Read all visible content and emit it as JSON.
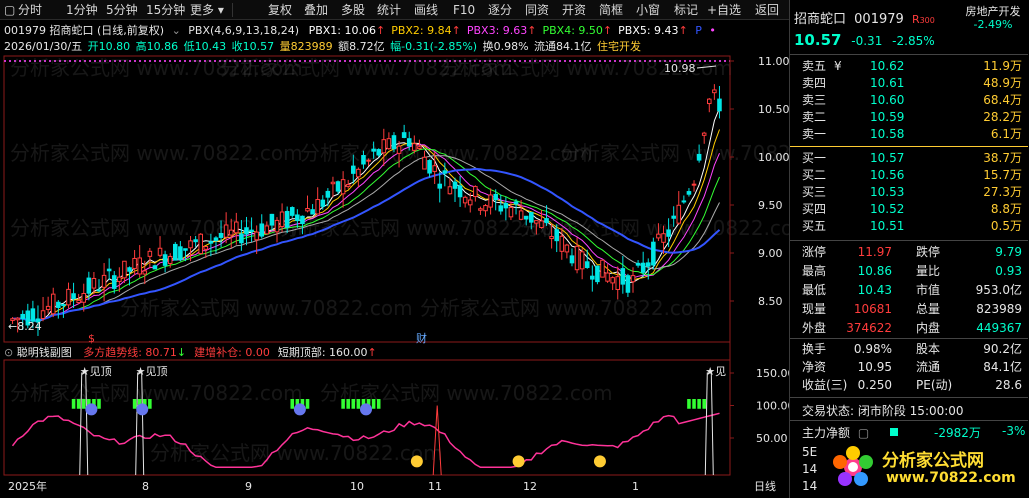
{
  "toolbar": {
    "periods": [
      "分时",
      "1分钟",
      "5分钟",
      "15分钟",
      "更多"
    ],
    "tools": [
      "复权",
      "叠加",
      "多股",
      "统计",
      "画线",
      "F10",
      "逐分",
      "同资",
      "开资",
      "简框",
      "小窗",
      "标记",
      "+自选",
      "返回"
    ]
  },
  "header": {
    "title": "001979 招商蛇口 (日线,前复权)",
    "indicator_name": "PBX(4,6,9,13,18,24)",
    "pbx": [
      {
        "label": "PBX1: 10.06",
        "color": "#ffffff"
      },
      {
        "label": "PBX2: 9.84",
        "color": "#ffcc00"
      },
      {
        "label": "PBX3: 9.63",
        "color": "#ff44ff"
      },
      {
        "label": "PBX4: 9.50",
        "color": "#33ff33"
      },
      {
        "label": "PBX5: 9.43",
        "color": "#ffffff"
      }
    ],
    "pbx_extra": "P",
    "line2": {
      "date": "2026/01/30/五",
      "open": "开10.80",
      "high": "高10.86",
      "low": "低10.43",
      "close": "收10.57",
      "volume": "量823989",
      "amount": "额8.72亿",
      "change": "幅-0.31(-2.85%)",
      "turnover": "换0.98%",
      "float": "流通84.1亿",
      "sector": "住宅开发"
    }
  },
  "main_chart": {
    "price_axis": [
      "11.00",
      "10.50",
      "10.00",
      "9.50",
      "9.00",
      "8.50"
    ],
    "annotations": {
      "high_label": "10.98",
      "low_label": "8.24",
      "marker_s": "$",
      "marker_cai": "财"
    },
    "watermark": "分析家公式网 www.70822.com"
  },
  "sub_chart": {
    "title": "聪明钱副图",
    "items": [
      {
        "label": "多方趋势线: 80.71",
        "color": "#ff3c3c",
        "arrow": "↓",
        "arrow_color": "#33ff33"
      },
      {
        "label": "建增补仓: 0.00",
        "color": "#ff3c3c",
        "arrow": "",
        "arrow_color": ""
      },
      {
        "label": "短期顶部: 160.00",
        "color": "#e6e6e6",
        "arrow": "↑",
        "arrow_color": "#ff3c3c"
      }
    ],
    "axis": [
      "150.00",
      "100.00",
      "50.00"
    ],
    "top_labels": [
      "★见顶",
      "★见顶",
      "★见"
    ]
  },
  "date_axis": [
    "2025年",
    "8",
    "9",
    "10",
    "11",
    "12",
    "1",
    "日线"
  ],
  "right_panel": {
    "name": "招商蛇口",
    "code": "001979",
    "badge": "R",
    "badge_num": "300",
    "sector": "房地产开发",
    "price": "10.57",
    "change": "-0.31",
    "change_pct": "-2.85%",
    "sector_pct": "-2.49%",
    "asks": [
      {
        "label": "卖五",
        "extra": "¥",
        "price": "10.62",
        "vol": "11.9万"
      },
      {
        "label": "卖四",
        "extra": "",
        "price": "10.61",
        "vol": "48.9万"
      },
      {
        "label": "卖三",
        "extra": "",
        "price": "10.60",
        "vol": "68.4万"
      },
      {
        "label": "卖二",
        "extra": "",
        "price": "10.59",
        "vol": "28.2万"
      },
      {
        "label": "卖一",
        "extra": "",
        "price": "10.58",
        "vol": "6.1万"
      }
    ],
    "bids": [
      {
        "label": "买一",
        "price": "10.57",
        "vol": "38.7万"
      },
      {
        "label": "买二",
        "price": "10.56",
        "vol": "15.7万"
      },
      {
        "label": "买三",
        "price": "10.53",
        "vol": "27.3万"
      },
      {
        "label": "买四",
        "price": "10.52",
        "vol": "8.8万"
      },
      {
        "label": "买五",
        "price": "10.51",
        "vol": "0.5万"
      }
    ],
    "stats": [
      {
        "l1": "涨停",
        "v1": "11.97",
        "c1": "red",
        "l2": "跌停",
        "v2": "9.79",
        "c2": "green"
      },
      {
        "l1": "最高",
        "v1": "10.86",
        "c1": "green",
        "l2": "量比",
        "v2": "0.93",
        "c2": "green"
      },
      {
        "l1": "最低",
        "v1": "10.43",
        "c1": "green",
        "l2": "市值",
        "v2": "953.0亿",
        "c2": "white"
      },
      {
        "l1": "现量",
        "v1": "10681",
        "c1": "red",
        "l2": "总量",
        "v2": "823989",
        "c2": "white"
      },
      {
        "l1": "外盘",
        "v1": "374622",
        "c1": "red",
        "l2": "内盘",
        "v2": "449367",
        "c2": "green"
      }
    ],
    "stats2": [
      {
        "l1": "换手",
        "v1": "0.98%",
        "l2": "股本",
        "v2": "90.2亿"
      },
      {
        "l1": "净资",
        "v1": "10.95",
        "l2": "流通",
        "v2": "84.1亿"
      },
      {
        "l1": "收益(三)",
        "v1": "0.250",
        "l2": "PE(动)",
        "v2": "28.6"
      }
    ],
    "trade_status": "交易状态: 闭市阶段 15:00:00",
    "main_flow_label": "主力净额",
    "main_flow_value": "-2982万",
    "main_flow_pct": "-3%",
    "partial": [
      "5E",
      "14",
      "14"
    ],
    "logo_text": "分析家公式网",
    "logo_url": "www.70822.com"
  }
}
